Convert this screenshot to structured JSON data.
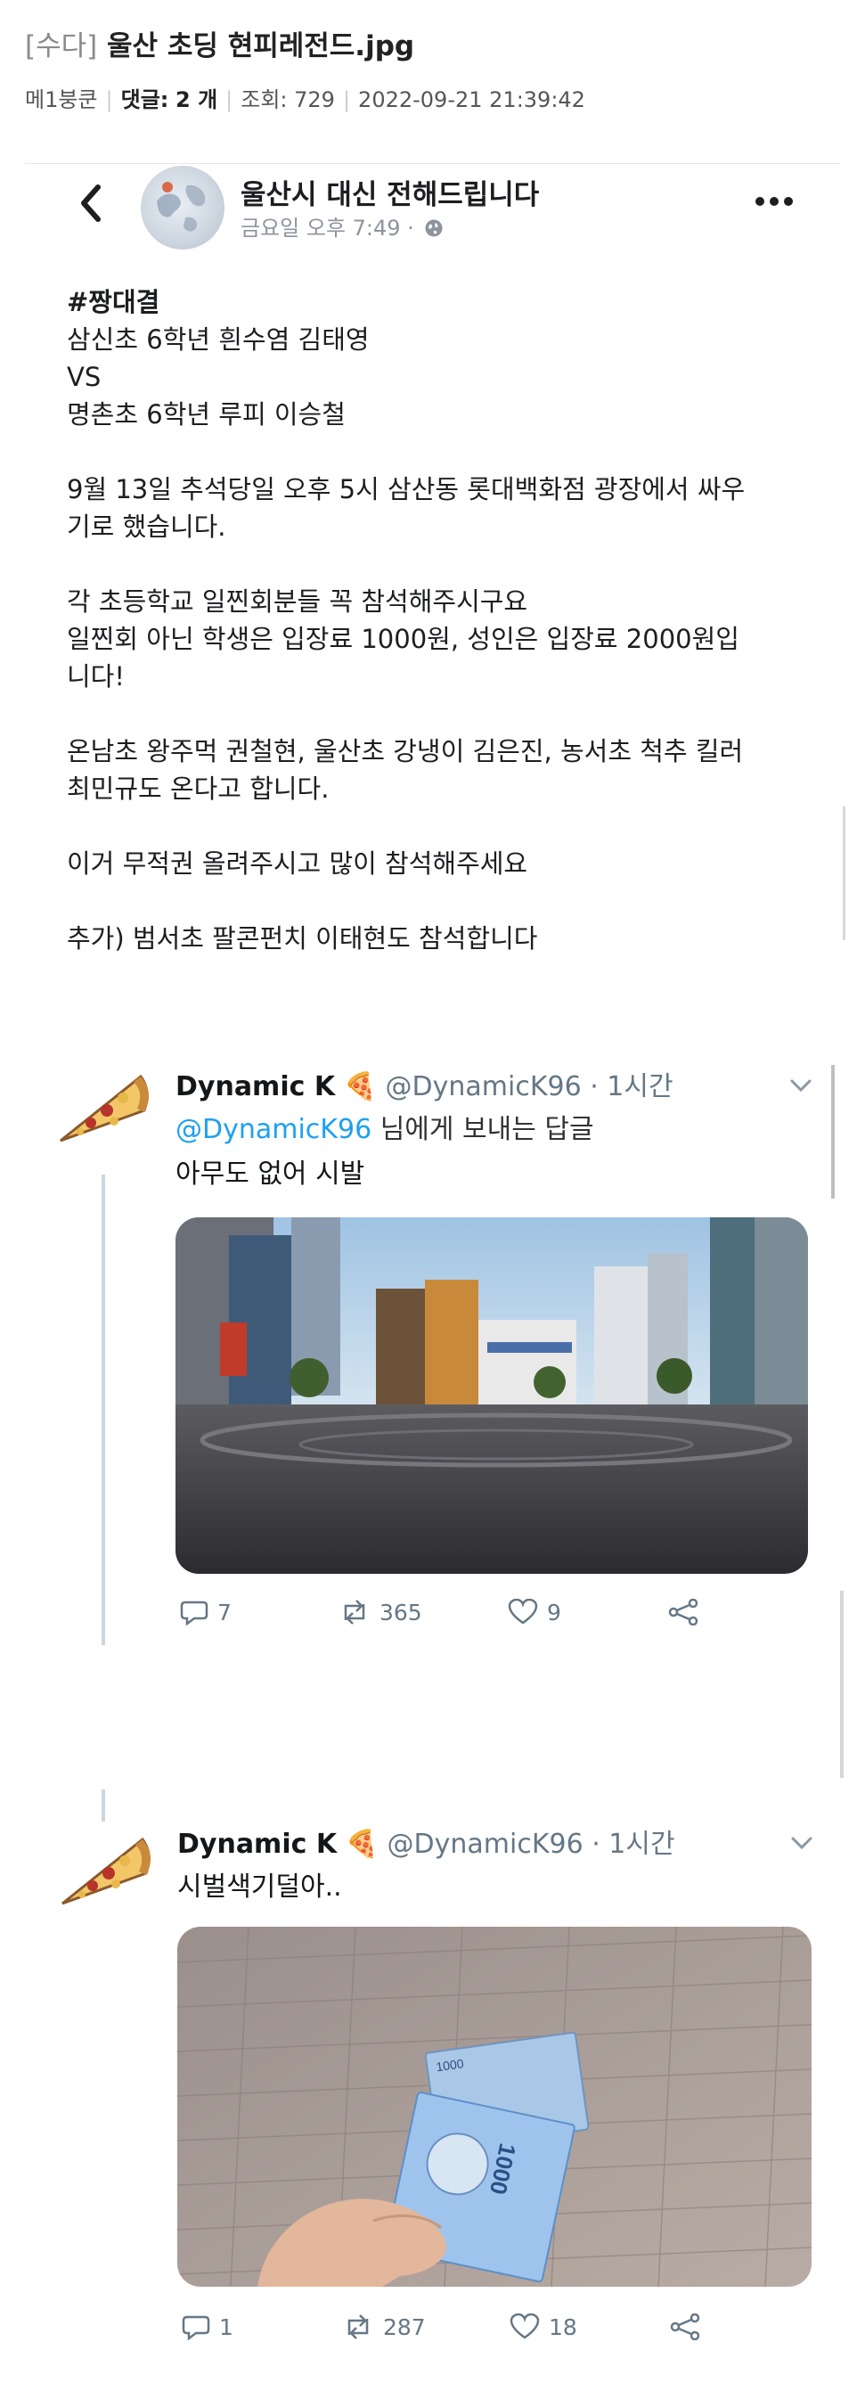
{
  "post": {
    "category": "[수다]",
    "title": "울산 초딩 현피레전드.jpg",
    "author": "메1붕쿤",
    "comments_label": "댓글:",
    "comments_count": "2 개",
    "views_label": "조회:",
    "views": "729",
    "datetime": "2022-09-21 21:39:42"
  },
  "fb": {
    "page_name": "울산시 대신 전해드립니다",
    "time": "금요일 오후 7:49 ·",
    "body": [
      "#짱대결",
      "삼신초 6학년 흰수염 김태영",
      "VS",
      "명촌초 6학년 루피 이승철",
      "9월 13일 추석당일 오후 5시 삼산동 롯대백화점 광장에서 싸우",
      "기로 했습니다.",
      "각 초등학교 일찐회분들 꼭 참석해주시구요",
      "일찐회 아닌 학생은 입장료 1000원, 성인은 입장료 2000원입",
      "니다!",
      "온남초 왕주먹 권철현, 울산초 강냉이 김은진, 농서초 척추 킬러",
      "최민규도 온다고 합니다.",
      "이거 무적권 올려주시고 많이 참석해주세요",
      "추가) 범서초 팔콘펀치 이태현도 참석합니다"
    ]
  },
  "tweets": [
    {
      "name": "Dynamic K",
      "handle": "@DynamicK96",
      "time": "· 1시간",
      "reply_handle": "@DynamicK96",
      "reply_suffix": " 님에게 보내는 답글",
      "text": "아무도 없어 시발",
      "replies": "7",
      "retweets": "365",
      "likes": "9"
    },
    {
      "name": "Dynamic K",
      "handle": "@DynamicK96",
      "time": "· 1시간",
      "text": "시벌색기덜아..",
      "replies": "1",
      "retweets": "287",
      "likes": "18"
    }
  ],
  "photo2_banknote": "1000",
  "colors": {
    "twitter_blue": "#1da1f2",
    "muted": "#657786",
    "fb_muted": "#8d949e"
  }
}
